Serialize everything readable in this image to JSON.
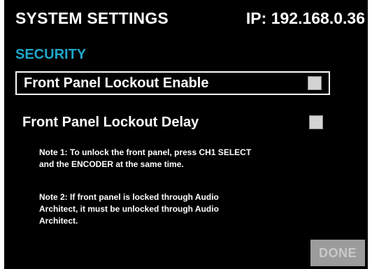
{
  "header": {
    "title": "SYSTEM SETTINGS",
    "ip_label": "IP: 192.168.0.36"
  },
  "section": {
    "title": "SECURITY"
  },
  "options": [
    {
      "label": "Front Panel Lockout Enable",
      "checked": false,
      "selected": true
    },
    {
      "label": "Front Panel Lockout Delay",
      "checked": false,
      "selected": false
    }
  ],
  "notes": [
    {
      "line1": "Note 1: To unlock the front panel, press CH1 SELECT",
      "line2": "and the ENCODER at the same time."
    },
    {
      "line1": "Note 2: If front panel is locked through Audio",
      "line2": "Architect, it must be unlocked through Audio",
      "line3": "Architect."
    }
  ],
  "actions": {
    "done_label": "DONE"
  },
  "colors": {
    "background": "#000000",
    "text": "#ffffff",
    "accent": "#1ea7c8",
    "checkbox": "#d3d3d3",
    "done_button": "#9c9c9c"
  }
}
